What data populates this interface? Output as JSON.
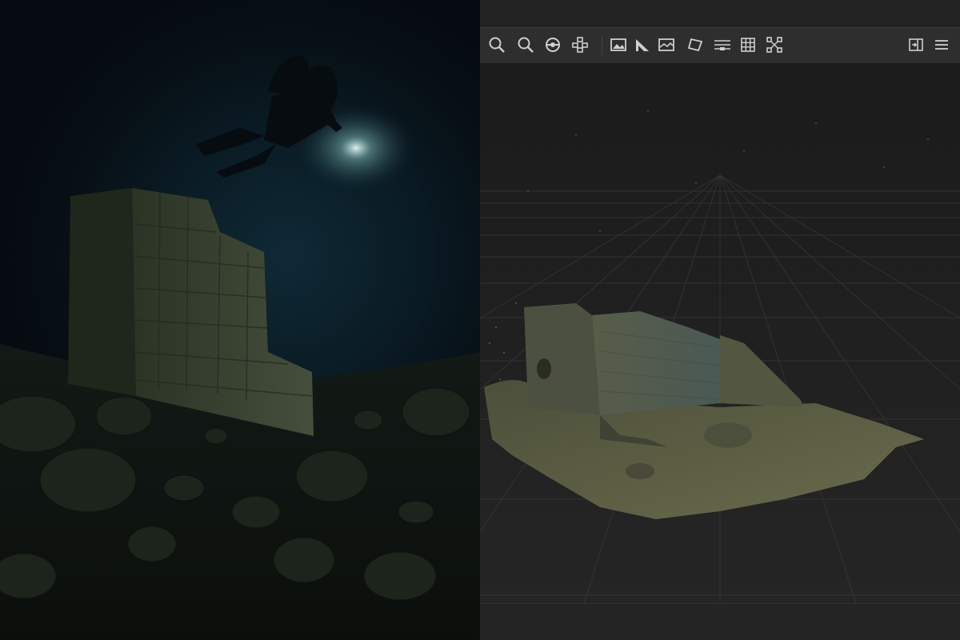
{
  "photo": {
    "subject": "",
    "colors": {
      "water_dark": "#050b10",
      "water_mid": "#0f2a36",
      "light_beam": "#cfe9e8",
      "stone": "#3d4a38",
      "seafloor": "#1b2219"
    }
  },
  "viewer": {
    "toolbar": {
      "left_tools": [
        {
          "icon": "zoom-in-icon"
        },
        {
          "icon": "zoom-out-icon"
        },
        {
          "icon": "orbit-icon"
        },
        {
          "icon": "nodes-icon"
        }
      ],
      "middle_tools": [
        {
          "icon": "image-icon"
        },
        {
          "icon": "slope-icon"
        },
        {
          "icon": "panorama-icon"
        },
        {
          "icon": "plane-icon"
        },
        {
          "icon": "align-icon"
        },
        {
          "icon": "grid-icon"
        },
        {
          "icon": "bounding-box-icon"
        }
      ],
      "right_tools": [
        {
          "icon": "panel-toggle-icon"
        },
        {
          "icon": "menu-icon"
        }
      ]
    },
    "colors": {
      "background": "#1e1e1e",
      "toolbar": "#2e2e2e",
      "grid_line": "#3a3a3a",
      "model": "#5e5f44",
      "icon": "#cfcfcf"
    }
  }
}
